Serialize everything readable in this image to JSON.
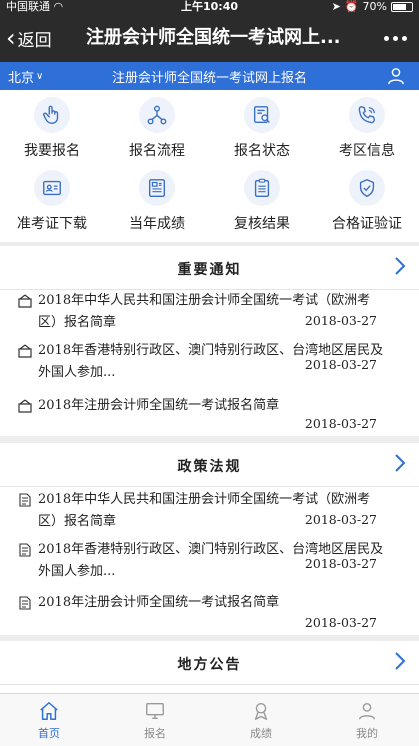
{
  "status_bar": {
    "carrier": "中国联通",
    "time": "上午10:40",
    "battery": "70%",
    "battery_level": 0.7
  },
  "nav": {
    "back_label": "返回",
    "title": "注册会计师全国统一考试网上..."
  },
  "header": {
    "city": "北京",
    "title": "注册会计师全国统一考试网上报名"
  },
  "grid": [
    {
      "label": "我要报名",
      "icon": "hand-pointer-icon"
    },
    {
      "label": "报名流程",
      "icon": "flowchart-icon"
    },
    {
      "label": "报名状态",
      "icon": "document-search-icon"
    },
    {
      "label": "考区信息",
      "icon": "phone-icon"
    },
    {
      "label": "准考证下载",
      "icon": "id-card-icon"
    },
    {
      "label": "当年成绩",
      "icon": "report-icon"
    },
    {
      "label": "复核结果",
      "icon": "clipboard-icon"
    },
    {
      "label": "合格证验证",
      "icon": "shield-check-icon"
    }
  ],
  "sections": [
    {
      "title": "重要通知",
      "items": [
        {
          "text": "2018年中华人民共和国注册会计师全国统一考试（欧洲考区）报名简章",
          "date": "2018-03-27"
        },
        {
          "text": "2018年香港特别行政区、澳门特别行政区、台湾地区居民及外国人参加...",
          "date": "2018-03-27"
        },
        {
          "text": "2018年注册会计师全国统一考试报名简章",
          "date": "2018-03-27"
        }
      ]
    },
    {
      "title": "政策法规",
      "items": [
        {
          "text": "2018年中华人民共和国注册会计师全国统一考试（欧洲考区）报名简章",
          "date": "2018-03-27"
        },
        {
          "text": "2018年香港特别行政区、澳门特别行政区、台湾地区居民及外国人参加...",
          "date": "2018-03-27"
        },
        {
          "text": "2018年注册会计师全国统一考试报名简章",
          "date": "2018-03-27"
        }
      ]
    },
    {
      "title": "地方公告",
      "items": []
    }
  ],
  "tabs": [
    {
      "label": "首页",
      "icon": "home-icon",
      "active": true
    },
    {
      "label": "报名",
      "icon": "computer-icon",
      "active": false
    },
    {
      "label": "成绩",
      "icon": "medal-icon",
      "active": false
    },
    {
      "label": "我的",
      "icon": "person-icon",
      "active": false
    }
  ],
  "colors": {
    "accent": "#2f6fd8",
    "nav_bg": "#2b2b2b",
    "icon_blue": "#3a6fc4"
  }
}
